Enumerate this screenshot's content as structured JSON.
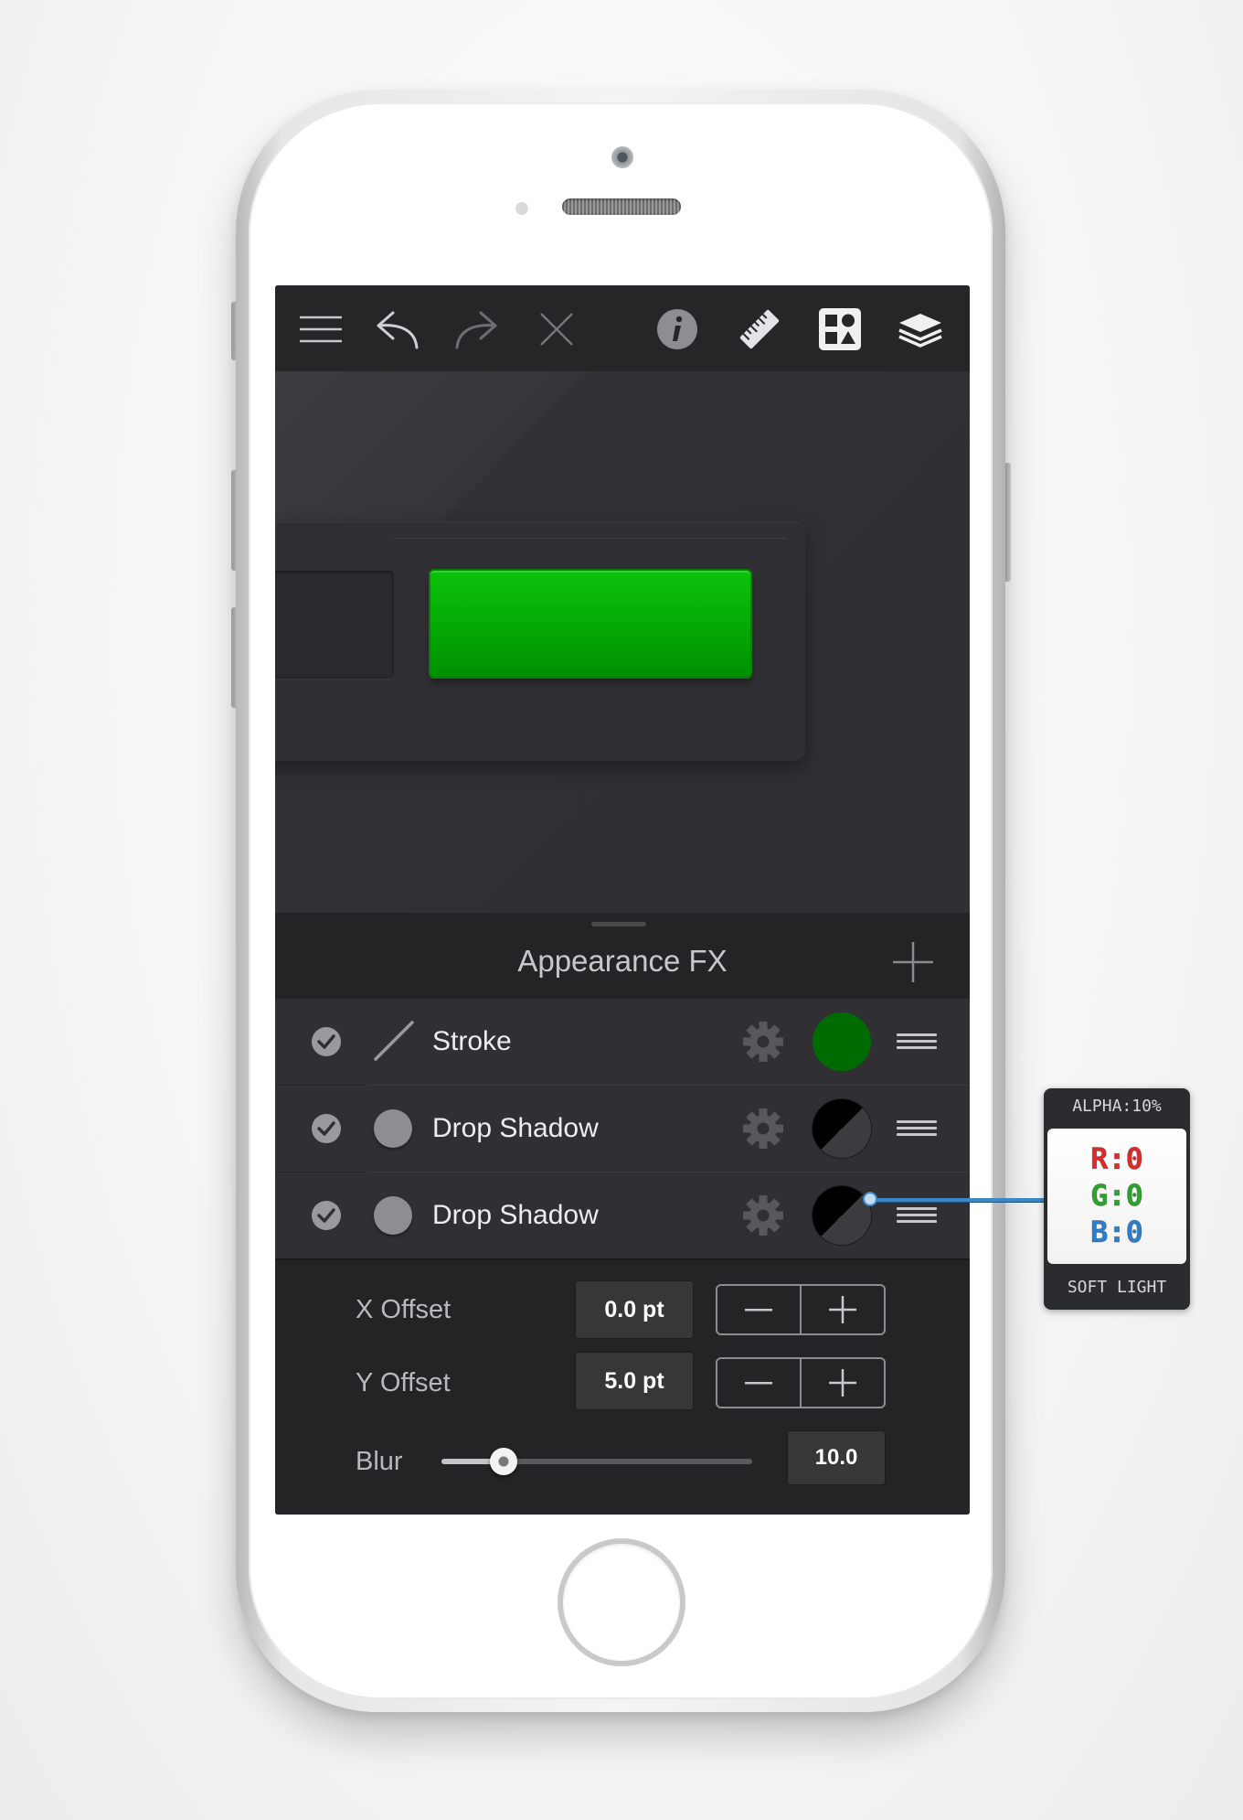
{
  "toolbar": {
    "icons": [
      "menu-icon",
      "undo-icon",
      "redo-icon",
      "close-icon",
      "info-icon",
      "ruler-icon",
      "shapes-icon",
      "layers-icon"
    ]
  },
  "panel": {
    "title": "Appearance FX",
    "effects": [
      {
        "label": "Stroke",
        "enabled": true,
        "color": "#006b00"
      },
      {
        "label": "Drop Shadow",
        "enabled": true,
        "color": "#000000"
      },
      {
        "label": "Drop Shadow",
        "enabled": true,
        "color": "#000000"
      }
    ]
  },
  "settings": {
    "x_offset": {
      "label": "X Offset",
      "value": "0.0 pt"
    },
    "y_offset": {
      "label": "Y Offset",
      "value": "5.0 pt"
    },
    "blur": {
      "label": "Blur",
      "value": "10.0",
      "level": 0.2
    }
  },
  "callout": {
    "alpha": "ALPHA:10%",
    "r": "R:0",
    "g": "G:0",
    "b": "B:0",
    "blend": "SOFT LIGHT"
  },
  "colors": {
    "accent_green": "#04a804",
    "callout_line": "#3e86c4",
    "r_color": "#e02a2a",
    "g_color": "#2aa62a",
    "b_color": "#2a7fd0"
  }
}
